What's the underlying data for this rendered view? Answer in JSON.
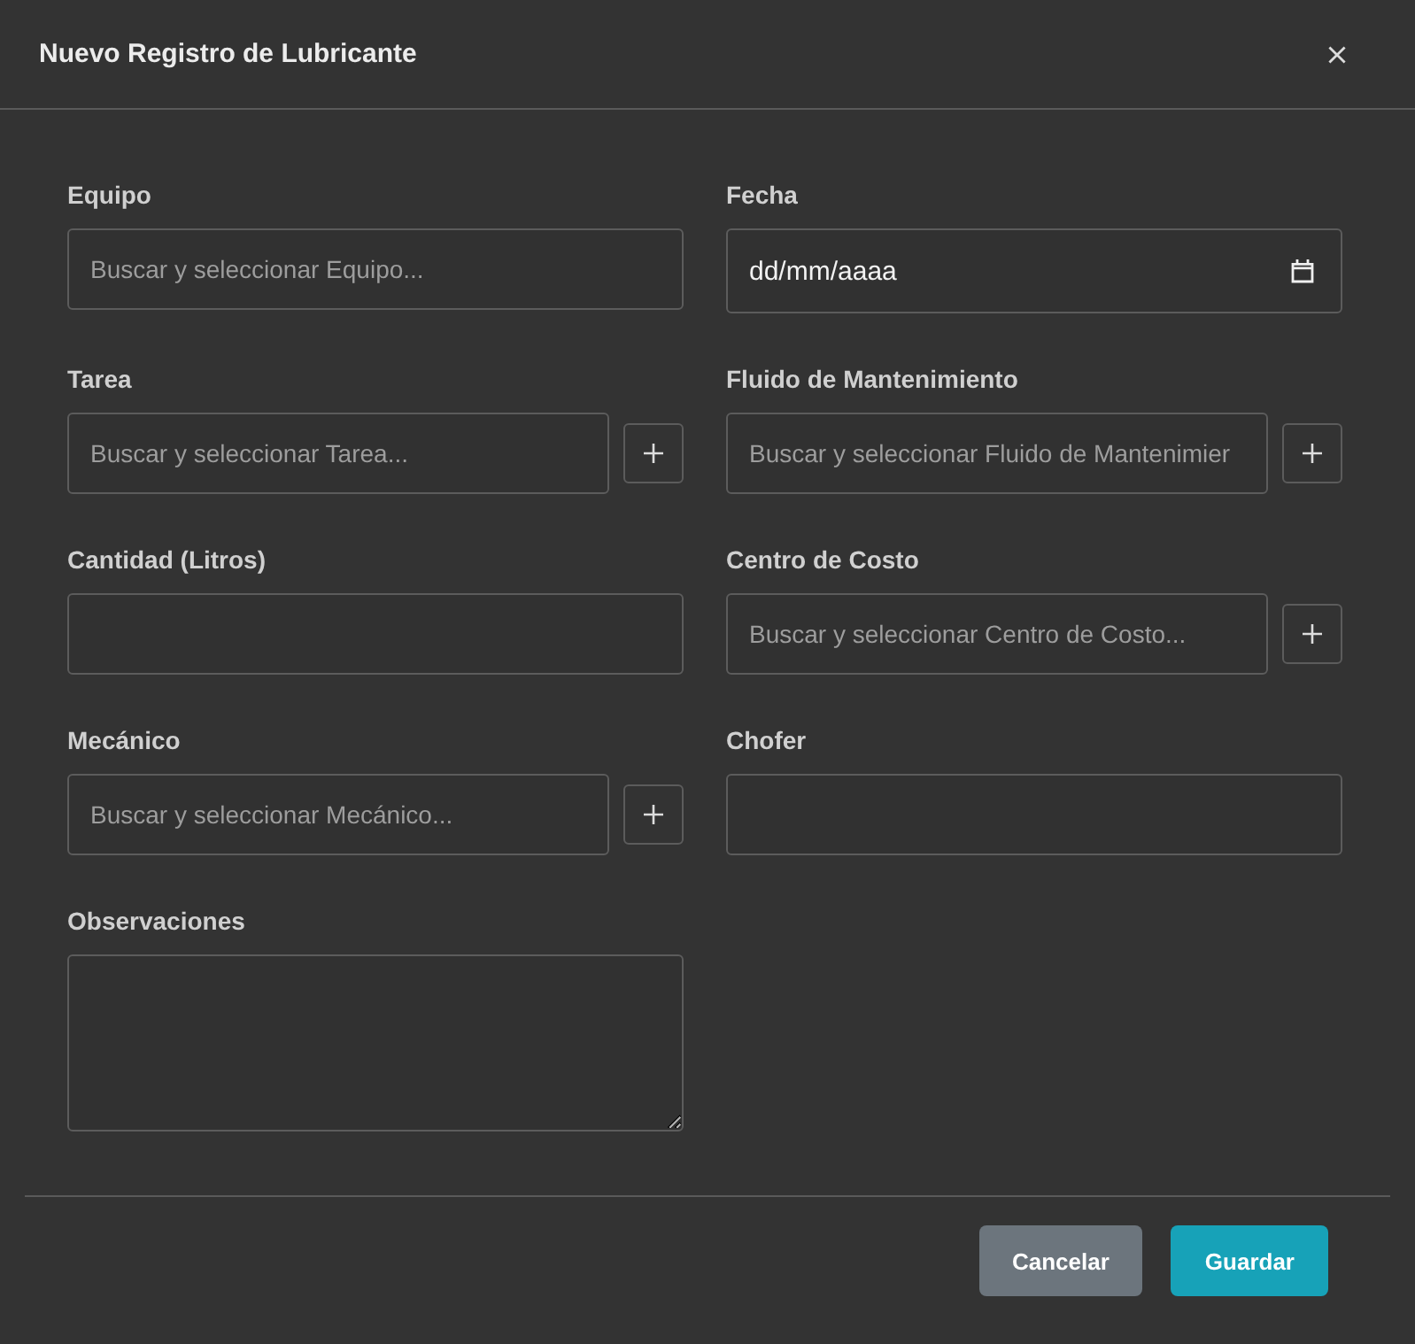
{
  "dialog": {
    "title": "Nuevo Registro de Lubricante"
  },
  "fields": [
    {
      "label": "Equipo",
      "kind": "search",
      "placeholder": "Buscar y seleccionar Equipo...",
      "add_button": false
    },
    {
      "label": "Fecha",
      "kind": "date",
      "placeholder": "dd/mm/aaaa",
      "add_button": false
    },
    {
      "label": "Tarea",
      "kind": "search",
      "placeholder": "Buscar y seleccionar Tarea...",
      "add_button": true
    },
    {
      "label": "Fluido de Mantenimiento",
      "kind": "search",
      "placeholder": "Buscar y seleccionar Fluido de Mantenimier",
      "add_button": true
    },
    {
      "label": "Cantidad (Litros)",
      "kind": "text",
      "add_button": false
    },
    {
      "label": "Centro de Costo",
      "kind": "search",
      "placeholder": "Buscar y seleccionar Centro de Costo...",
      "add_button": true
    },
    {
      "label": "Mecánico",
      "kind": "search",
      "placeholder": "Buscar y seleccionar Mecánico...",
      "add_button": true
    },
    {
      "label": "Chofer",
      "kind": "text",
      "add_button": false
    },
    {
      "label": "Observaciones",
      "kind": "textarea",
      "add_button": false
    }
  ],
  "buttons": [
    {
      "label": "Cancelar",
      "kind": "secondary"
    },
    {
      "label": "Guardar",
      "kind": "primary"
    }
  ]
}
